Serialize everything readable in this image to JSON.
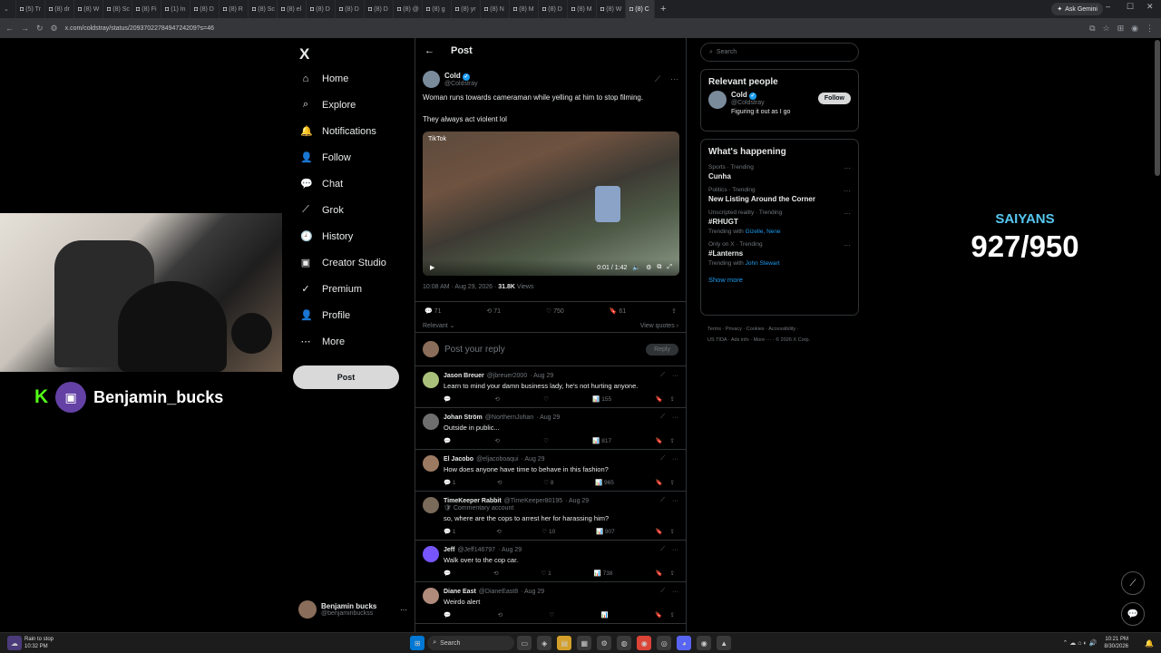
{
  "browser": {
    "tabs": [
      "(5) Tr",
      "(8) dr",
      "(8) W",
      "(8) Sc",
      "(8) Fi",
      "(1) In",
      "(8) D",
      "(8) R",
      "(8) Sc",
      "(8) el",
      "(8) D",
      "(8) D",
      "(8) D",
      "(8) @",
      "(8) g",
      "(8) yr",
      "(8) N",
      "(8) M",
      "(8) D",
      "(8) M",
      "(8) W",
      "(8) C"
    ],
    "active_tab_index": 21,
    "gemini_label": "Ask Gemini",
    "url": "x.com/coldstray/status/2093702278494724209?s=46"
  },
  "nav": {
    "logo": "X",
    "items": [
      {
        "label": "Home",
        "icon": "⌂"
      },
      {
        "label": "Explore",
        "icon": "⌕"
      },
      {
        "label": "Notifications",
        "icon": "🔔"
      },
      {
        "label": "Follow",
        "icon": "👤"
      },
      {
        "label": "Chat",
        "icon": "💬"
      },
      {
        "label": "Grok",
        "icon": "⟋"
      },
      {
        "label": "History",
        "icon": "🕘"
      },
      {
        "label": "Creator Studio",
        "icon": "▣"
      },
      {
        "label": "Premium",
        "icon": "✓"
      },
      {
        "label": "Profile",
        "icon": "👤"
      },
      {
        "label": "More",
        "icon": "⋯"
      }
    ],
    "post_button": "Post",
    "account": {
      "name": "Benjamin bucks",
      "handle": "@benjaminbuckss",
      "more": "···"
    }
  },
  "post": {
    "header": "Post",
    "author_name": "Cold",
    "author_handle": "@Coldstray",
    "text1": "Woman runs towards cameraman while yelling at him to stop filming.",
    "text2": "They always act violent lol",
    "video_time": "0:01 / 1:42",
    "video_watermark": "TikTok",
    "meta_time": "10:08 AM · Aug 29, 2026 · ",
    "meta_views_count": "31.8K",
    "meta_views_label": " Views",
    "replies": "71",
    "reposts": "71",
    "likes": "750",
    "bookmarks": "61",
    "relevant": "Relevant",
    "view_quotes": "View quotes",
    "reply_placeholder": "Post your reply",
    "reply_button": "Reply"
  },
  "replies": [
    {
      "name": "Jason Breuer",
      "handle": "@jbreuer2000",
      "date": "· Aug 29",
      "text": "Learn to mind your damn business lady, he's not hurting anyone.",
      "replies": "",
      "reposts": "",
      "likes": "",
      "views": "155",
      "av": "#a9c07a"
    },
    {
      "name": "Johan Ström",
      "handle": "@NorthernJohan",
      "date": "· Aug 29",
      "text": "Outside in public...",
      "replies": "",
      "reposts": "",
      "likes": "",
      "views": "817",
      "av": "#6e6e6e"
    },
    {
      "name": "El Jacobo",
      "handle": "@eljacoboaqui",
      "date": "· Aug 29",
      "text": "How does anyone have time to behave in this fashion?",
      "replies": "1",
      "reposts": "",
      "likes": "8",
      "views": "965",
      "av": "#9c7a62"
    },
    {
      "name": "TimeKeeper Rabbit",
      "handle": "@TimeKeeper80195",
      "date": "· Aug 29",
      "sub": "🛡 Commentary account",
      "text": "so, where are the cops to arrest her for harassing him?",
      "replies": "1",
      "reposts": "",
      "likes": "10",
      "views": "907",
      "av": "#7a6a5a"
    },
    {
      "name": "Jeff",
      "handle": "@Jeff146797",
      "date": "· Aug 29",
      "text": "Walk over to the cop car.",
      "replies": "",
      "reposts": "",
      "likes": "1",
      "views": "738",
      "av": "#7856ff"
    },
    {
      "name": "Diane East",
      "handle": "@DianeEast8",
      "date": "· Aug 29",
      "text": "Weirdo alert",
      "replies": "",
      "reposts": "",
      "likes": "",
      "views": "",
      "av": "#b08a7a"
    }
  ],
  "sidebar": {
    "search_placeholder": "Search",
    "relevant_title": "Relevant people",
    "person": {
      "name": "Cold",
      "handle": "@Coldstray",
      "bio": "Figuring it out as I go",
      "follow": "Follow"
    },
    "happening_title": "What's happening",
    "trends": [
      {
        "cat": "Sports · Trending",
        "title": "Cunha",
        "with_label": "",
        "with": ""
      },
      {
        "cat": "Politics · Trending",
        "title": "New Listing Around the Corner",
        "with_label": "",
        "with": ""
      },
      {
        "cat": "Unscripted reality · Trending",
        "title": "#RHUGT",
        "with_label": "Trending with ",
        "with": "Gizelle, Nene"
      },
      {
        "cat": "Only on X · Trending",
        "title": "#Lanterns",
        "with_label": "Trending with ",
        "with": "John Stewart"
      }
    ],
    "show_more": "Show more",
    "footer1": "Terms  ·  Privacy  ·  Cookies  ·  Accessibility  ·",
    "footer2": "US TIDA  ·  Ads info  ·  More ···  ·  © 2026 X Corp."
  },
  "overlay": {
    "twitch_name": "Benjamin_bucks",
    "kick": "K",
    "saiyans_label": "SAIYANS",
    "saiyans_count": "927/950"
  },
  "taskbar": {
    "weather": "Rain to stop",
    "weather_time": "10:32 PM",
    "search": "Search",
    "clock_time": "10:21 PM",
    "clock_date": "8/30/2026"
  },
  "colors": {
    "accent": "#1d9bf0",
    "kick": "#53fc18",
    "twitch": "#6441a5",
    "saiyans": "#56c8f1"
  }
}
